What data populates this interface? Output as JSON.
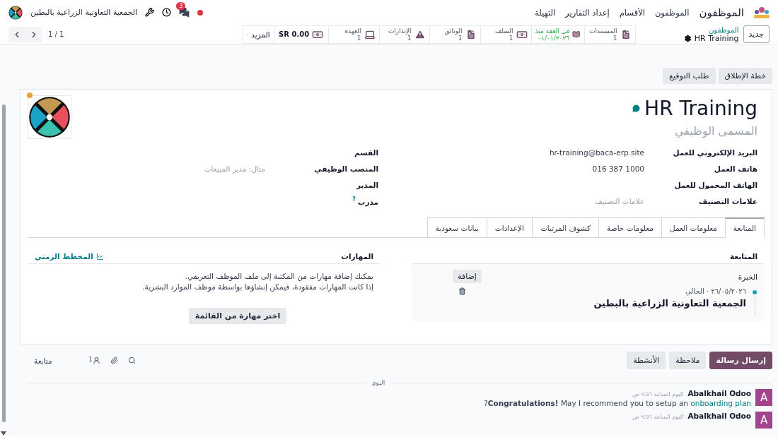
{
  "navbar": {
    "app_title": "الموظفون",
    "menu": [
      "الموظفون",
      "الأقسام",
      "إعداد التقارير",
      "التهيلة"
    ],
    "chat_badge": "3",
    "company": "الجمعية التعاونية الزراعية بالبطين"
  },
  "control_panel": {
    "new_button": "جديد",
    "breadcrumb": "الموظفون",
    "record": "HR Training",
    "pager": "1 / 1"
  },
  "smart_buttons": [
    {
      "kind": "document",
      "label": "المستندات",
      "value": "1"
    },
    {
      "kind": "contract",
      "label": "في العقد منذ",
      "value": "٠١/٠١/٢٠٢٦"
    },
    {
      "kind": "cash",
      "label": "السلف",
      "value": "1"
    },
    {
      "kind": "document",
      "label": "الوثائق",
      "value": "1"
    },
    {
      "kind": "warning",
      "label": "الإنذارات",
      "value": "1"
    },
    {
      "kind": "laptop",
      "label": "العهدة",
      "value": "1"
    },
    {
      "kind": "amount",
      "value": "0.00 SR"
    },
    {
      "kind": "more",
      "label": "المزيد"
    }
  ],
  "header_buttons": [
    "خطة الإطلاق",
    "طلب التوقيع"
  ],
  "employee": {
    "name": "HR Training",
    "job_title_placeholder": "المسمى الوظيفي"
  },
  "fields_right": [
    {
      "label": "البريد الإلكتروني للعمل",
      "value": "hr-training@baca-erp.site"
    },
    {
      "label": "هاتف العمل",
      "value": "016 387 1000"
    },
    {
      "label": "الهاتف المحمول للعمل"
    },
    {
      "label": "علامات التصنيف",
      "placeholder": "علامات التصنيف"
    }
  ],
  "fields_left": [
    {
      "label": "القسم"
    },
    {
      "label": "المنصب الوظيفي",
      "placeholder": "مثال: مدير المبيعات"
    },
    {
      "label": "المدير"
    },
    {
      "label": "مدرب",
      "help": "?"
    }
  ],
  "tabs": [
    {
      "label": "المتابعة",
      "selected": true
    },
    {
      "label": "معلومات العمل",
      "selected": false
    },
    {
      "label": "معلومات خاصة",
      "selected": false
    },
    {
      "label": "كشوف المرتبات",
      "selected": false
    },
    {
      "label": "الإعدادات",
      "selected": false
    },
    {
      "label": "بيانات سعودية",
      "selected": false
    }
  ],
  "resume": {
    "section": "المتابعة",
    "group": "الخبرة",
    "add_button": "إضافة",
    "entries": [
      {
        "dates": "٢٦/٠٥/٢٠٢٦ · الحالي",
        "title": "الجمعية التعاونية الزراعية بالبطين"
      }
    ]
  },
  "skills": {
    "title": "المهارات",
    "timeline_link": "المخطط الزمني",
    "help": [
      "يمكنك إضافة مهارات من المكتبة إلى ملف الموظف التعريفي.",
      "إذا كانت المهارات مفقودة، فيمكن إنشاؤها بواسطة موظف الموارد البشرية."
    ],
    "button": "اختر مهارة من القائمة"
  },
  "chatter": {
    "buttons": [
      {
        "label": "إرسال رسالة",
        "primary": true
      },
      {
        "label": "ملاحظة",
        "primary": false
      },
      {
        "label": "الأنشطة",
        "primary": false
      }
    ],
    "followers_count": "1",
    "follow": "متابعة",
    "today": "اليوم",
    "messages": [
      {
        "avatar": "A",
        "author": "Abalkhail Odoo",
        "time": "اليوم الساعة ٩:٥٦ ص",
        "before": "**Congratulations!** May I recommend you to setup an",
        "link": "onboarding plan",
        "after": "?"
      },
      {
        "avatar": "A",
        "author": "Abalkhail Odoo",
        "time": "اليوم الساعة ٩:٥٦ ص"
      }
    ]
  }
}
